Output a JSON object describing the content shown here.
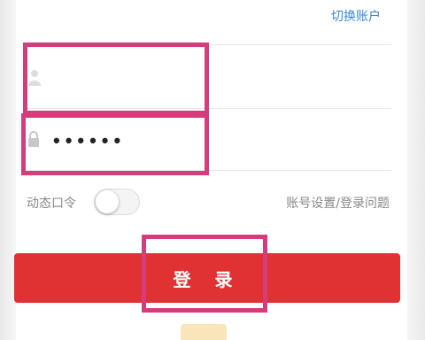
{
  "header": {
    "switch_account": "切换账户"
  },
  "login_form": {
    "username": {
      "value": "",
      "icon": "user-icon"
    },
    "password": {
      "value": "••••••",
      "icon": "lock-icon"
    },
    "dynamic_password": {
      "label": "动态口令",
      "enabled": false
    },
    "account_settings_link": "账号设置/登录问题",
    "login_button_label": "登 录"
  },
  "colors": {
    "accent_blue": "#3a87d6",
    "login_red": "#e03232",
    "highlight_pink": "#d43c7c"
  }
}
